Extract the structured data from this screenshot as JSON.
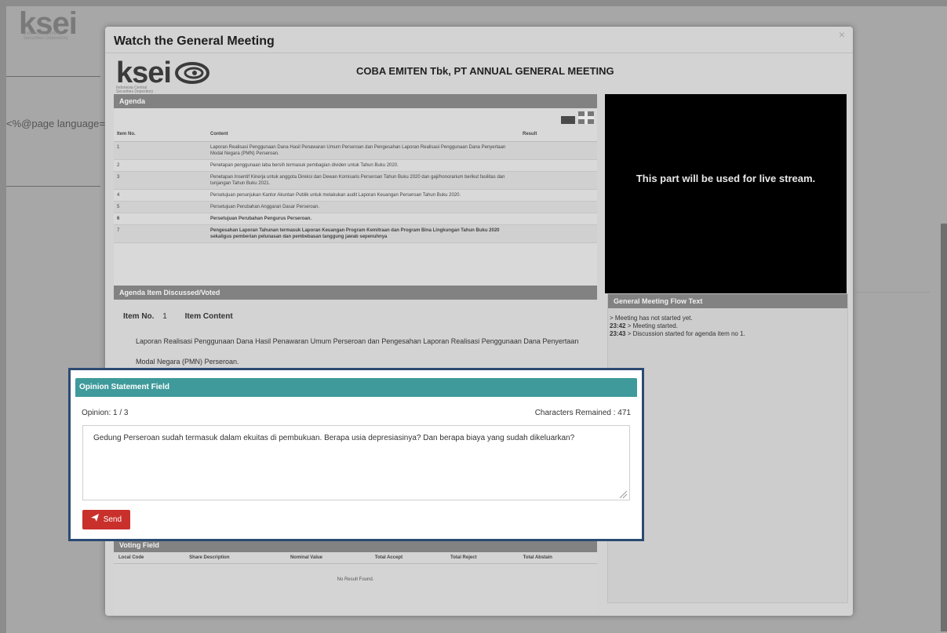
{
  "background": {
    "logo_text": "ksei",
    "logo_sub": "Indonesia Central Securities Depository",
    "code_text": "<%@page language=\"ja"
  },
  "modal": {
    "title": "Watch the General Meeting",
    "close": "×",
    "logo_text": "ksei",
    "logo_sub": "Indonesia Central Securities Depository",
    "meeting_title": "COBA EMITEN Tbk, PT ANNUAL GENERAL MEETING"
  },
  "agenda": {
    "header": "Agenda",
    "columns": [
      "Item No.",
      "Content",
      "Result"
    ],
    "rows": [
      {
        "no": "1",
        "content": "Laporan Realisasi Penggunaan Dana Hasil Penawaran Umum Perseroan dan Pengesahan Laporan Realisasi Penggunaan Dana Penyertaan Modal Negara (PMN) Perseroan.",
        "result": ""
      },
      {
        "no": "2",
        "content": "Penetapan penggunaan laba bersih termasuk pembagian dividen untuk Tahun Buku 2020.",
        "result": ""
      },
      {
        "no": "3",
        "content": "Penetapan Insentif Kinerja untuk anggota Direksi dan Dewan Komisaris Perseroan Tahun Buku 2020 dan gaji/honorarium berikut fasilitas dan tunjangan Tahun Buku 2021.",
        "result": ""
      },
      {
        "no": "4",
        "content": "Persetujuan penunjukan Kantor Akuntan Publik untuk melakukan audit Laporan Keuangan Perseroan Tahun Buku 2020.",
        "result": ""
      },
      {
        "no": "5",
        "content": "Persetujuan Perubahan Anggaran Dasar Perseroan.",
        "result": ""
      },
      {
        "no": "6",
        "content": "Persetujuan Perubahan Pengurus Perseroan.",
        "result": ""
      },
      {
        "no": "7",
        "content": "Pengesahan Laporan Tahunan termasuk Laporan Keuangan Program Kemitraan dan Program Bina Lingkungan Tahun Buku 2020 sekaligus pemberian pelunasan dan pembebasan tanggung jawab sepenuhnya",
        "result": ""
      }
    ]
  },
  "video": {
    "text": "This part will be used for live stream."
  },
  "discussed": {
    "header": "Agenda Item Discussed/Voted",
    "item_no_label": "Item No.",
    "item_no_value": "1",
    "item_content_label": "Item Content",
    "content": "Laporan Realisasi Penggunaan Dana Hasil Penawaran Umum Perseroan dan Pengesahan Laporan Realisasi Penggunaan Dana Penyertaan Modal Negara (PMN) Perseroan."
  },
  "flow": {
    "header": "General Meeting Flow Text",
    "lines": [
      {
        "time": "",
        "text": "> Meeting has not started yet."
      },
      {
        "time": "23:42",
        "text": " > Meeting started."
      },
      {
        "time": "23:43",
        "text": " > Discussion started for agenda item no 1."
      }
    ]
  },
  "voting": {
    "header": "Voting Field",
    "columns": [
      "Local Code",
      "Share Description",
      "Nominal Value",
      "Total Accept",
      "Total Reject",
      "Total Abstain"
    ],
    "empty": "No Result Found."
  },
  "opinion": {
    "header": "Opinion Statement Field",
    "count_label": "Opinion: 1 / 3",
    "chars_label": "Characters Remained : 471",
    "text": "Gedung Perseroan sudah termasuk dalam ekuitas di pembukuan. Berapa usia depresiasinya? Dan berapa biaya yang sudah dikeluarkan?",
    "send_label": "Send"
  }
}
